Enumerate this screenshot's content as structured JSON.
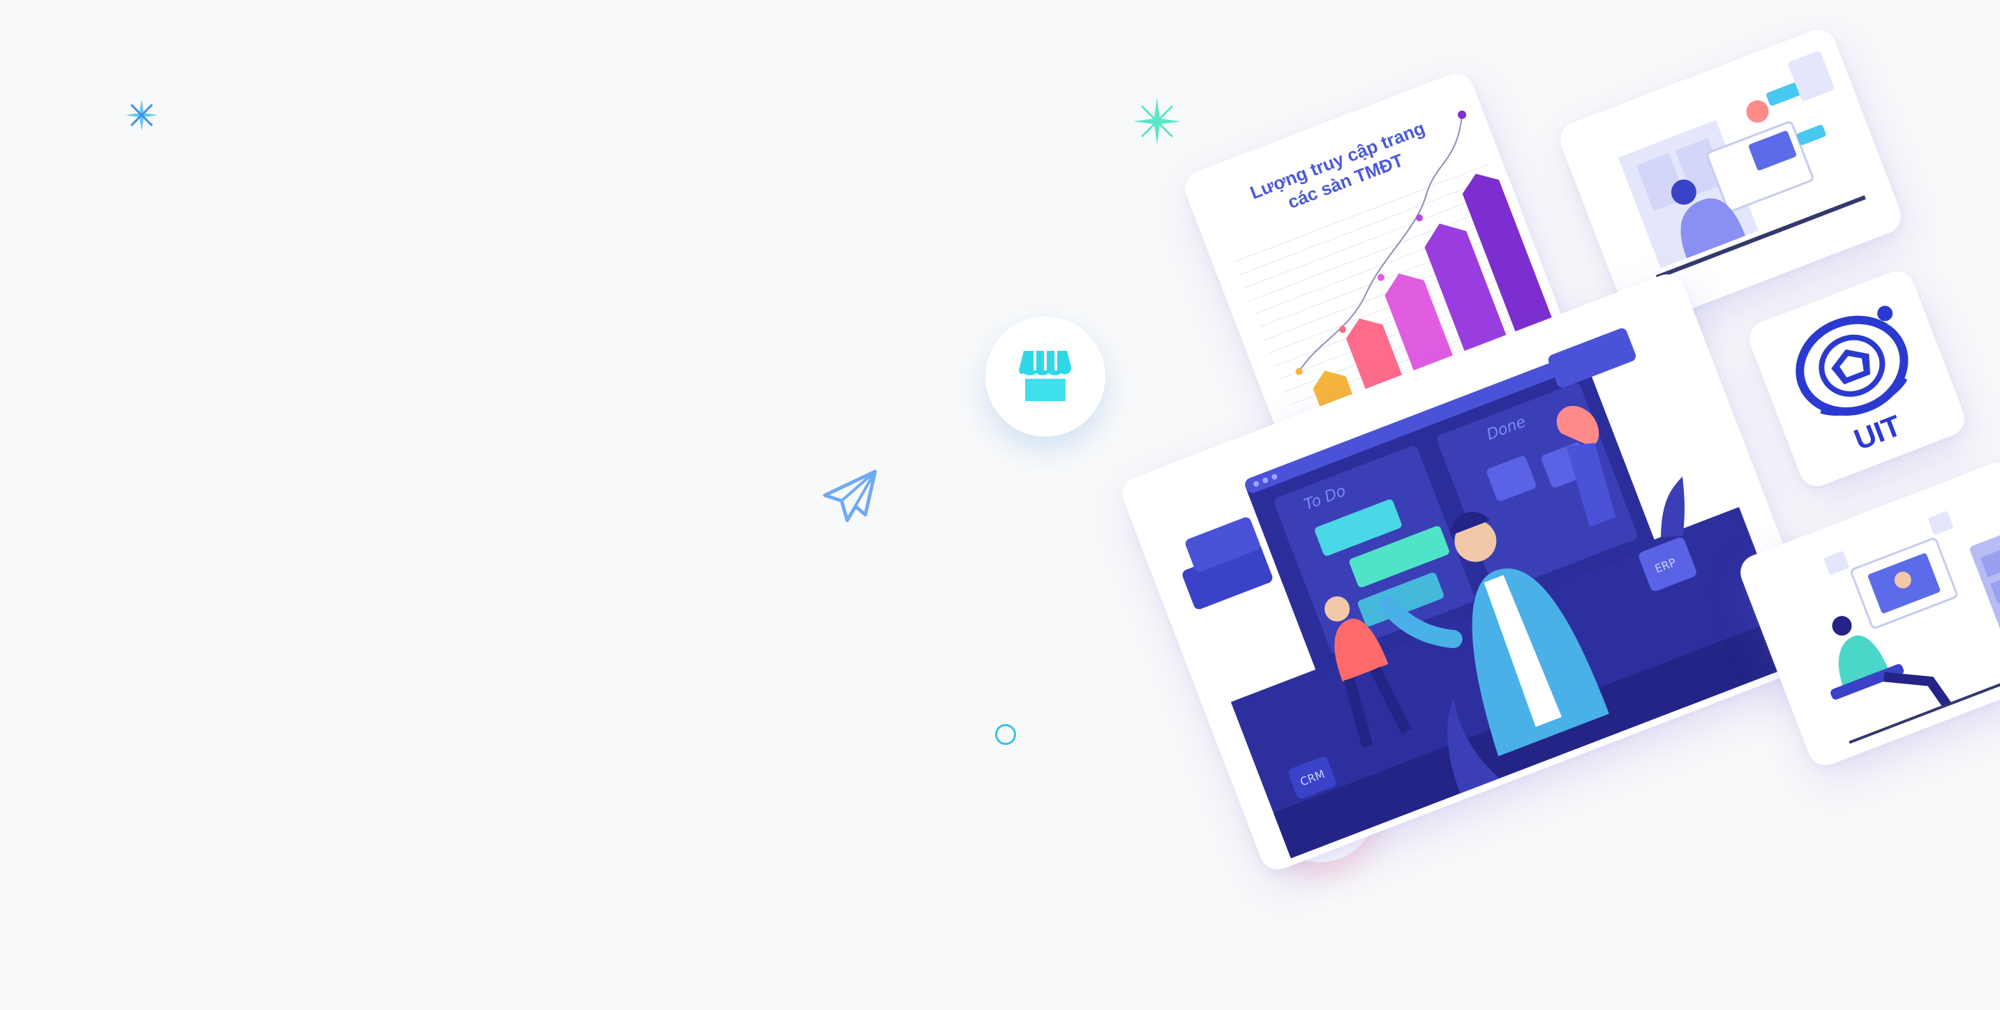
{
  "hero": {
    "chart_card": {
      "title_line1": "Lượng truy cập trang",
      "title_line2": "các sàn TMĐT"
    },
    "uit_card": {
      "label": "UIT"
    },
    "board": {
      "todo_label": "To Do",
      "done_label": "Done"
    },
    "tags": {
      "crm": "CRM",
      "erp": "ERP"
    }
  },
  "colors": {
    "background": "#f8f9fa",
    "accent_blue": "#3a42c8",
    "accent_cyan": "#2fd3e6",
    "accent_red": "#ff4d6d",
    "sparkle_teal": "#4fe3c8"
  },
  "icons": {
    "store": "store-icon",
    "cart": "shopping-cart-icon",
    "paper_plane": "paper-plane-icon",
    "sparkle": "sparkle-icon"
  }
}
